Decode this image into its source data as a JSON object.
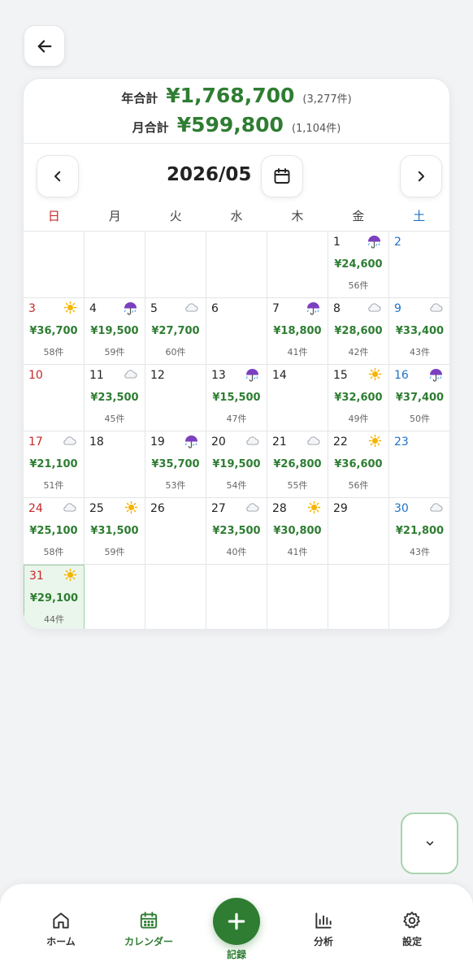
{
  "totals": {
    "year_label": "年合計",
    "year_amount": "¥1,768,700",
    "year_count": "(3,277件)",
    "month_label": "月合計",
    "month_amount": "¥599,800",
    "month_count": "(1,104件)"
  },
  "month_title": "2026/05",
  "weekdays": [
    "日",
    "月",
    "火",
    "水",
    "木",
    "金",
    "土"
  ],
  "leading_blank_days": 5,
  "days": [
    {
      "day": "1",
      "weather": "umbrella-icon",
      "amount": "¥24,600",
      "count": "56件"
    },
    {
      "day": "2",
      "weather": "",
      "amount": "",
      "count": ""
    },
    {
      "day": "3",
      "weather": "sun-icon",
      "amount": "¥36,700",
      "count": "58件"
    },
    {
      "day": "4",
      "weather": "umbrella-icon",
      "amount": "¥19,500",
      "count": "59件"
    },
    {
      "day": "5",
      "weather": "cloud-icon",
      "amount": "¥27,700",
      "count": "60件"
    },
    {
      "day": "6",
      "weather": "",
      "amount": "",
      "count": ""
    },
    {
      "day": "7",
      "weather": "umbrella-icon",
      "amount": "¥18,800",
      "count": "41件"
    },
    {
      "day": "8",
      "weather": "cloud-icon",
      "amount": "¥28,600",
      "count": "42件"
    },
    {
      "day": "9",
      "weather": "cloud-icon",
      "amount": "¥33,400",
      "count": "43件"
    },
    {
      "day": "10",
      "weather": "",
      "amount": "",
      "count": ""
    },
    {
      "day": "11",
      "weather": "cloud-icon",
      "amount": "¥23,500",
      "count": "45件"
    },
    {
      "day": "12",
      "weather": "",
      "amount": "",
      "count": ""
    },
    {
      "day": "13",
      "weather": "umbrella-icon",
      "amount": "¥15,500",
      "count": "47件"
    },
    {
      "day": "14",
      "weather": "",
      "amount": "",
      "count": ""
    },
    {
      "day": "15",
      "weather": "sun-icon",
      "amount": "¥32,600",
      "count": "49件"
    },
    {
      "day": "16",
      "weather": "umbrella-icon",
      "amount": "¥37,400",
      "count": "50件"
    },
    {
      "day": "17",
      "weather": "cloud-icon",
      "amount": "¥21,100",
      "count": "51件"
    },
    {
      "day": "18",
      "weather": "",
      "amount": "",
      "count": ""
    },
    {
      "day": "19",
      "weather": "umbrella-icon",
      "amount": "¥35,700",
      "count": "53件"
    },
    {
      "day": "20",
      "weather": "cloud-icon",
      "amount": "¥19,500",
      "count": "54件"
    },
    {
      "day": "21",
      "weather": "cloud-icon",
      "amount": "¥26,800",
      "count": "55件"
    },
    {
      "day": "22",
      "weather": "sun-icon",
      "amount": "¥36,600",
      "count": "56件"
    },
    {
      "day": "23",
      "weather": "",
      "amount": "",
      "count": ""
    },
    {
      "day": "24",
      "weather": "cloud-icon",
      "amount": "¥25,100",
      "count": "58件"
    },
    {
      "day": "25",
      "weather": "sun-icon",
      "amount": "¥31,500",
      "count": "59件"
    },
    {
      "day": "26",
      "weather": "",
      "amount": "",
      "count": ""
    },
    {
      "day": "27",
      "weather": "cloud-icon",
      "amount": "¥23,500",
      "count": "40件"
    },
    {
      "day": "28",
      "weather": "sun-icon",
      "amount": "¥30,800",
      "count": "41件"
    },
    {
      "day": "29",
      "weather": "",
      "amount": "",
      "count": ""
    },
    {
      "day": "30",
      "weather": "cloud-icon",
      "amount": "¥21,800",
      "count": "43件"
    },
    {
      "day": "31",
      "weather": "sun-icon",
      "amount": "¥29,100",
      "count": "44件",
      "selected": true
    }
  ],
  "tabs": {
    "home": "ホーム",
    "calendar": "カレンダー",
    "record": "記録",
    "analysis": "分析",
    "settings": "設定"
  },
  "colors": {
    "accent": "#2e7d32",
    "sunday": "#c62828",
    "saturday": "#1e73c8",
    "selected_bg": "#eaf6ec"
  }
}
